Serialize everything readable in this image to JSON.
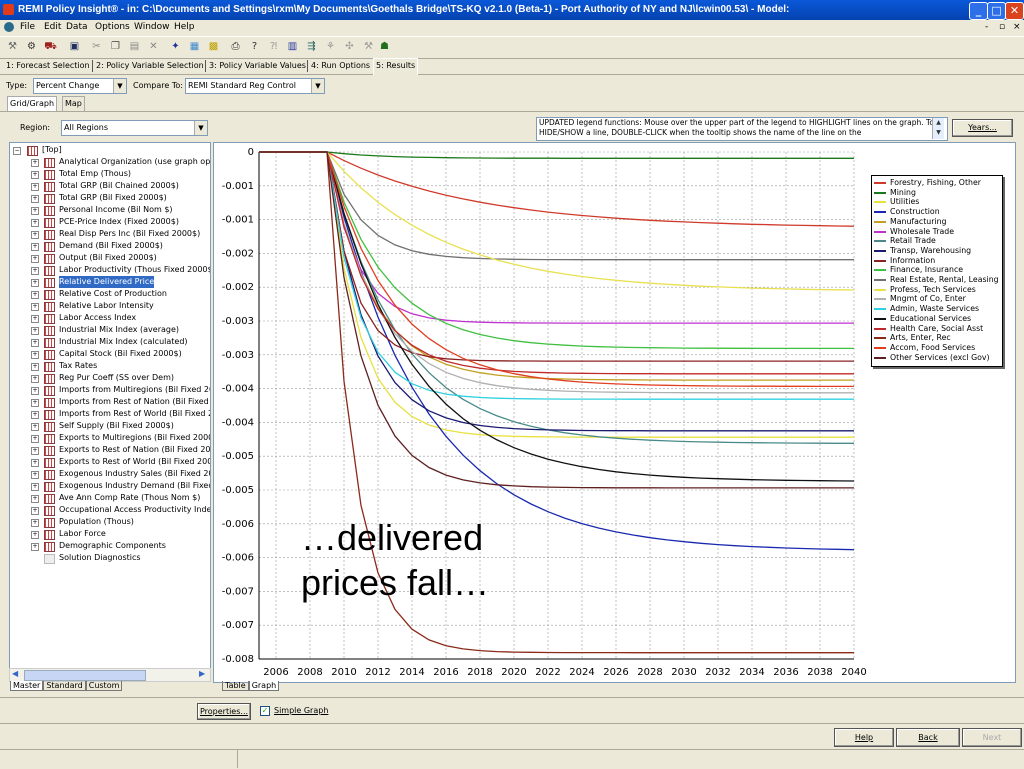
{
  "window": {
    "title": "REMI Policy Insight® - in: C:\\Documents and Settings\\rxm\\My Documents\\Goethals Bridge\\TS-KQ v2.1.0 (Beta-1) - Port Authority of NY and NJ\\lcwin00.53\\ - Model:",
    "min": "_",
    "max": "□",
    "close": "✕"
  },
  "menu": [
    "File",
    "Edit",
    "Data",
    "Options",
    "Window",
    "Help"
  ],
  "mdi_controls": [
    "-",
    "▫",
    "×"
  ],
  "tabs": [
    "1: Forecast Selection",
    "2: Policy Variable Selection",
    "3: Policy Variable Values",
    "4: Run Options",
    "5: Results"
  ],
  "type_label": "Type:",
  "type_value": "Percent Change",
  "compare_label": "Compare To:",
  "compare_value": "REMI Standard Reg Control",
  "subtabs": [
    "Grid/Graph",
    "Map"
  ],
  "region_label": "Region:",
  "region_value": "All Regions",
  "legend_note": "UPDATED legend functions: Mouse over the upper part of the legend to HIGHLIGHT lines on the graph. To HIDE/SHOW a line, DOUBLE-CLICK when the tooltip shows the name of the line on the",
  "years_button": "Years...",
  "tree": {
    "root": "[Top]",
    "items": [
      "Analytical Organization (use graph optic",
      "Total Emp (Thous)",
      "Total GRP (Bil Chained 2000$)",
      "Total GRP (Bil Fixed 2000$)",
      "Personal Income (Bil Nom $)",
      "PCE-Price Index (Fixed 2000$)",
      "Real Disp Pers Inc (Bil Fixed 2000$)",
      "Demand (Bil Fixed 2000$)",
      "Output (Bil Fixed 2000$)",
      "Labor Productivity (Thous Fixed 2000$)",
      "Relative Delivered Price",
      "Relative Cost of Production",
      "Relative Labor Intensity",
      "Labor Access Index",
      "Industrial Mix Index (average)",
      "Industrial Mix Index (calculated)",
      "Capital Stock (Bil Fixed 2000$)",
      "Tax Rates",
      "Reg Pur Coeff (SS over Dem)",
      "Imports from Multiregions (Bil Fixed 200",
      "Imports from Rest of Nation (Bil Fixed 2(",
      "Imports from Rest of World (Bil Fixed 20",
      "Self Supply (Bil Fixed 2000$)",
      "Exports to Multiregions (Bil Fixed 2000$",
      "Exports to Rest of Nation (Bil Fixed 200",
      "Exports to Rest of World (Bil Fixed 200(",
      "Exogenous Industry Sales (Bil Fixed 200",
      "Exogenous Industry Demand (Bil Fixed",
      "Ave Ann Comp Rate (Thous Nom $)",
      "Occupational Access Productivity Inde:",
      "Population (Thous)",
      "Labor Force",
      "Demographic Components"
    ],
    "last": "Solution Diagnostics",
    "selected_index": 10
  },
  "left_tabs": [
    "Master",
    "Standard",
    "Custom"
  ],
  "bottom_tabs": [
    "Table",
    "Graph"
  ],
  "properties_button": "Properties...",
  "simple_graph_label": "Simple Graph",
  "simple_graph_checked": true,
  "nav": {
    "help": "Help",
    "back": "Back",
    "next": "Next"
  },
  "overlay_text": [
    "…delivered",
    "prices fall…"
  ],
  "chart_data": {
    "type": "line",
    "title": "",
    "xlabel": "",
    "ylabel": "",
    "x": [
      2005,
      2006,
      2007,
      2008,
      2009,
      2010,
      2011,
      2012,
      2013,
      2014,
      2015,
      2016,
      2017,
      2018,
      2019,
      2020,
      2021,
      2022,
      2023,
      2024,
      2025,
      2026,
      2027,
      2028,
      2029,
      2030,
      2031,
      2032,
      2033,
      2034,
      2035,
      2036,
      2037,
      2038,
      2039,
      2040
    ],
    "xticks": [
      2006,
      2008,
      2010,
      2012,
      2014,
      2016,
      2018,
      2020,
      2022,
      2024,
      2026,
      2028,
      2030,
      2032,
      2034,
      2036,
      2038,
      2040
    ],
    "ytick_labels": [
      "0",
      "-0.001",
      "-0.001",
      "-0.002",
      "-0.002",
      "-0.003",
      "-0.003",
      "-0.004",
      "-0.004",
      "-0.005",
      "-0.005",
      "-0.006",
      "-0.006",
      "-0.007",
      "-0.007",
      "-0.008"
    ],
    "ylim": [
      -0.008,
      0
    ],
    "xlim": [
      2005,
      2040
    ],
    "grid": true,
    "legend_position": "right",
    "series": [
      {
        "name": "Forestry, Fishing, Other",
        "color": "#d03a2a",
        "end": -0.0012
      },
      {
        "name": "Mining",
        "color": "#1a7a1a",
        "end": -0.0001
      },
      {
        "name": "Utilities",
        "color": "#e8e040",
        "end": -0.0045
      },
      {
        "name": "Construction",
        "color": "#1a2ab0",
        "end": -0.0063
      },
      {
        "name": "Manufacturing",
        "color": "#c0a020",
        "end": -0.0036
      },
      {
        "name": "Wholesale Trade",
        "color": "#c030d0",
        "end": -0.0027
      },
      {
        "name": "Retail Trade",
        "color": "#4a8a8a",
        "end": -0.0046
      },
      {
        "name": "Transp, Warehousing",
        "color": "#1a1a70",
        "end": -0.0044
      },
      {
        "name": "Information",
        "color": "#8a2020",
        "end": -0.0033
      },
      {
        "name": "Finance, Insurance",
        "color": "#40c040",
        "end": -0.0031
      },
      {
        "name": "Real Estate, Rental, Leasing",
        "color": "#707070",
        "end": -0.0017
      },
      {
        "name": "Profess, Tech Services",
        "color": "#e8e050",
        "end": -0.0022
      },
      {
        "name": "Mngmt of Co, Enter",
        "color": "#b0b0b0",
        "end": -0.0038
      },
      {
        "name": "Admin, Waste Services",
        "color": "#30d0e0",
        "end": -0.0039
      },
      {
        "name": "Educational Services",
        "color": "#101010",
        "end": -0.0052
      },
      {
        "name": "Health Care, Social Asst",
        "color": "#c02a2a",
        "end": -0.0035
      },
      {
        "name": "Arts, Enter, Rec",
        "color": "#8b2a1a",
        "end": -0.0079
      },
      {
        "name": "Accom, Food Services",
        "color": "#e04020",
        "end": -0.0037
      },
      {
        "name": "Other Services (excl Gov)",
        "color": "#602020",
        "end": -0.0053
      }
    ]
  }
}
